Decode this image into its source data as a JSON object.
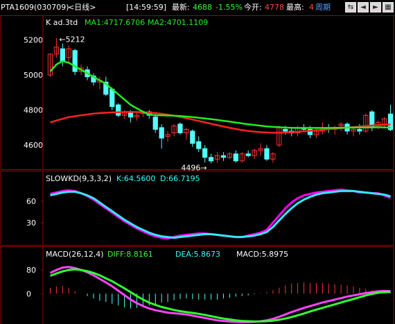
{
  "header": {
    "symbol": "PTA1609",
    "code": "(030709)",
    "period": "<日线>",
    "time": "[14:59:59]",
    "latest_label": "最新:",
    "latest_value": "4688",
    "change": "-1.55%",
    "open_label": "今开:",
    "open_value": "4778",
    "high_label": "最高:",
    "high_value": "4",
    "cycle_label": "周期",
    "nav_icons": [
      "swap-icon",
      "arrow-left-icon",
      "arrow-right-icon",
      "grid-icon"
    ]
  },
  "colors": {
    "up": "#ff3232",
    "down": "#54ffff",
    "ma1": "#ff2222",
    "ma2": "#22ee22",
    "k": "#ff00ff",
    "d": "#33e8ff",
    "diff": "#ff44ff",
    "dea": "#33ff33",
    "border": "#a00000",
    "axis_text": "#ffffff"
  },
  "chart_data": [
    {
      "type": "candlestick",
      "title": "K  ad.3td",
      "ma1_label": "MA1:4717.6706",
      "ma2_label": "MA2:4701.1109",
      "yticks": [
        "5200",
        "5000",
        "4800",
        "4600"
      ],
      "ylim": [
        4470,
        5270
      ],
      "annotation_high": "←5212",
      "annotation_low": "4496→",
      "candles": [
        {
          "o": 5000,
          "h": 5120,
          "l": 4990,
          "c": 5120
        },
        {
          "o": 5120,
          "h": 5212,
          "l": 5100,
          "c": 5160
        },
        {
          "o": 5150,
          "h": 5180,
          "l": 5050,
          "c": 5080
        },
        {
          "o": 5100,
          "h": 5170,
          "l": 5070,
          "c": 5150
        },
        {
          "o": 5140,
          "h": 5150,
          "l": 5000,
          "c": 5020
        },
        {
          "o": 5020,
          "h": 5060,
          "l": 5000,
          "c": 5040
        },
        {
          "o": 5030,
          "h": 5050,
          "l": 4970,
          "c": 4990
        },
        {
          "o": 4995,
          "h": 5010,
          "l": 4940,
          "c": 4960
        },
        {
          "o": 4960,
          "h": 4990,
          "l": 4920,
          "c": 4970
        },
        {
          "o": 4960,
          "h": 4990,
          "l": 4880,
          "c": 4890
        },
        {
          "o": 4920,
          "h": 4930,
          "l": 4800,
          "c": 4820
        },
        {
          "o": 4830,
          "h": 4840,
          "l": 4760,
          "c": 4770
        },
        {
          "o": 4770,
          "h": 4800,
          "l": 4750,
          "c": 4790
        },
        {
          "o": 4790,
          "h": 4800,
          "l": 4730,
          "c": 4760
        },
        {
          "o": 4760,
          "h": 4790,
          "l": 4740,
          "c": 4770
        },
        {
          "o": 4780,
          "h": 4800,
          "l": 4760,
          "c": 4790
        },
        {
          "o": 4790,
          "h": 4800,
          "l": 4750,
          "c": 4770
        },
        {
          "o": 4760,
          "h": 4780,
          "l": 4670,
          "c": 4690
        },
        {
          "o": 4700,
          "h": 4720,
          "l": 4580,
          "c": 4640
        },
        {
          "o": 4650,
          "h": 4680,
          "l": 4620,
          "c": 4660
        },
        {
          "o": 4670,
          "h": 4720,
          "l": 4650,
          "c": 4710
        },
        {
          "o": 4720,
          "h": 4730,
          "l": 4660,
          "c": 4670
        },
        {
          "o": 4670,
          "h": 4700,
          "l": 4630,
          "c": 4690
        },
        {
          "o": 4680,
          "h": 4690,
          "l": 4590,
          "c": 4610
        },
        {
          "o": 4620,
          "h": 4650,
          "l": 4560,
          "c": 4580
        },
        {
          "o": 4580,
          "h": 4600,
          "l": 4500,
          "c": 4530
        },
        {
          "o": 4530,
          "h": 4550,
          "l": 4496,
          "c": 4510
        },
        {
          "o": 4520,
          "h": 4560,
          "l": 4500,
          "c": 4540
        },
        {
          "o": 4540,
          "h": 4560,
          "l": 4510,
          "c": 4530
        },
        {
          "o": 4530,
          "h": 4560,
          "l": 4520,
          "c": 4550
        },
        {
          "o": 4550,
          "h": 4570,
          "l": 4500,
          "c": 4510
        },
        {
          "o": 4510,
          "h": 4560,
          "l": 4500,
          "c": 4550
        },
        {
          "o": 4550,
          "h": 4570,
          "l": 4530,
          "c": 4540
        },
        {
          "o": 4540,
          "h": 4580,
          "l": 4520,
          "c": 4570
        },
        {
          "o": 4570,
          "h": 4610,
          "l": 4540,
          "c": 4580
        },
        {
          "o": 4580,
          "h": 4600,
          "l": 4510,
          "c": 4520
        },
        {
          "o": 4520,
          "h": 4560,
          "l": 4500,
          "c": 4550
        },
        {
          "o": 4600,
          "h": 4710,
          "l": 4590,
          "c": 4700
        },
        {
          "o": 4690,
          "h": 4710,
          "l": 4660,
          "c": 4680
        },
        {
          "o": 4680,
          "h": 4700,
          "l": 4650,
          "c": 4670
        },
        {
          "o": 4670,
          "h": 4710,
          "l": 4650,
          "c": 4700
        },
        {
          "o": 4700,
          "h": 4720,
          "l": 4680,
          "c": 4690
        },
        {
          "o": 4690,
          "h": 4710,
          "l": 4640,
          "c": 4660
        },
        {
          "o": 4660,
          "h": 4700,
          "l": 4640,
          "c": 4680
        },
        {
          "o": 4680,
          "h": 4730,
          "l": 4660,
          "c": 4700
        },
        {
          "o": 4700,
          "h": 4720,
          "l": 4670,
          "c": 4690
        },
        {
          "o": 4690,
          "h": 4710,
          "l": 4660,
          "c": 4700
        },
        {
          "o": 4710,
          "h": 4730,
          "l": 4680,
          "c": 4720
        },
        {
          "o": 4720,
          "h": 4730,
          "l": 4660,
          "c": 4680
        },
        {
          "o": 4680,
          "h": 4700,
          "l": 4650,
          "c": 4690
        },
        {
          "o": 4690,
          "h": 4720,
          "l": 4660,
          "c": 4680
        },
        {
          "o": 4680,
          "h": 4780,
          "l": 4670,
          "c": 4770
        },
        {
          "o": 4790,
          "h": 4800,
          "l": 4680,
          "c": 4700
        },
        {
          "o": 4700,
          "h": 4740,
          "l": 4690,
          "c": 4730
        },
        {
          "o": 4720,
          "h": 4760,
          "l": 4700,
          "c": 4750
        },
        {
          "o": 4778,
          "h": 4830,
          "l": 4680,
          "c": 4688
        }
      ],
      "ma1": [
        4730,
        4740,
        4750,
        4760,
        4765,
        4770,
        4775,
        4780,
        4783,
        4785,
        4787,
        4788,
        4789,
        4790,
        4789,
        4788,
        4786,
        4783,
        4779,
        4774,
        4768,
        4761,
        4754,
        4746,
        4738,
        4730,
        4722,
        4714,
        4706,
        4699,
        4692,
        4686,
        4681,
        4677,
        4674,
        4672,
        4671,
        4671,
        4672,
        4674,
        4676,
        4679,
        4682,
        4685,
        4688,
        4691,
        4694,
        4697,
        4700,
        4703,
        4706,
        4709,
        4712,
        4714,
        4716,
        4718
      ],
      "ma2": [
        5020,
        5060,
        5080,
        5070,
        5050,
        5030,
        5010,
        4990,
        4970,
        4950,
        4920,
        4890,
        4860,
        4830,
        4810,
        4790,
        4775,
        4770,
        4770,
        4769,
        4768,
        4766,
        4763,
        4760,
        4756,
        4752,
        4748,
        4744,
        4739,
        4734,
        4729,
        4724,
        4719,
        4715,
        4711,
        4707,
        4704,
        4702,
        4700,
        4699,
        4698,
        4698,
        4698,
        4698,
        4698,
        4698,
        4699,
        4699,
        4700,
        4700,
        4701,
        4701,
        4701,
        4702,
        4701,
        4701
      ]
    },
    {
      "type": "line",
      "title": "SLOWKD(9,3,3,2)",
      "k_label": "K:64.5600",
      "d_label": "D:66.7195",
      "yticks": [
        "60",
        "30"
      ],
      "ylim": [
        0,
        85
      ],
      "series": [
        {
          "name": "K",
          "values": [
            70,
            72,
            74,
            75,
            74,
            71,
            67,
            62,
            56,
            50,
            44,
            38,
            32,
            27,
            22,
            18,
            14,
            11,
            9,
            8,
            10,
            12,
            13,
            14,
            15,
            15,
            14,
            13,
            12,
            11,
            10,
            10,
            12,
            14,
            16,
            20,
            30,
            40,
            50,
            58,
            64,
            68,
            70,
            72,
            73,
            74,
            75,
            76,
            75,
            74,
            72,
            72,
            71,
            71,
            68,
            64.56
          ]
        },
        {
          "name": "D",
          "values": [
            68,
            70,
            72,
            73,
            73,
            71,
            68,
            64,
            58,
            52,
            46,
            40,
            34,
            29,
            24,
            20,
            16,
            13,
            11,
            10,
            9,
            10,
            11,
            12,
            13,
            14,
            14,
            13,
            12,
            11,
            10,
            10,
            11,
            12,
            14,
            17,
            24,
            33,
            42,
            50,
            57,
            62,
            66,
            69,
            71,
            72,
            73,
            74,
            74,
            74,
            73,
            72,
            71,
            70,
            69,
            66.72
          ]
        }
      ]
    },
    {
      "type": "line",
      "title": "MACD(26,12,4)",
      "diff_label": "DIFF:8.8161",
      "dea_label": "DEA:5.8673",
      "macd_label": "MACD:5.8975",
      "yticks": [
        "80",
        "0"
      ],
      "ylim": [
        -100,
        120
      ],
      "series": [
        {
          "name": "DIFF",
          "values": [
            70,
            80,
            88,
            90,
            86,
            80,
            72,
            62,
            50,
            38,
            25,
            10,
            -5,
            -20,
            -32,
            -42,
            -50,
            -56,
            -60,
            -64,
            -66,
            -68,
            -70,
            -74,
            -78,
            -82,
            -86,
            -90,
            -92,
            -94,
            -95,
            -96,
            -96,
            -95,
            -93,
            -90,
            -85,
            -78,
            -70,
            -62,
            -55,
            -48,
            -42,
            -36,
            -30,
            -25,
            -20,
            -15,
            -10,
            -6,
            -2,
            2,
            5,
            8,
            9,
            8.82
          ]
        },
        {
          "name": "DEA",
          "values": [
            60,
            68,
            75,
            80,
            82,
            80,
            76,
            70,
            62,
            52,
            42,
            30,
            18,
            5,
            -8,
            -20,
            -30,
            -38,
            -45,
            -50,
            -55,
            -59,
            -62,
            -65,
            -68,
            -72,
            -76,
            -80,
            -84,
            -87,
            -90,
            -92,
            -93,
            -94,
            -94,
            -93,
            -91,
            -88,
            -84,
            -79,
            -73,
            -67,
            -60,
            -54,
            -48,
            -42,
            -36,
            -30,
            -24,
            -18,
            -12,
            -6,
            -1,
            3,
            5,
            5.87
          ]
        }
      ]
    }
  ]
}
